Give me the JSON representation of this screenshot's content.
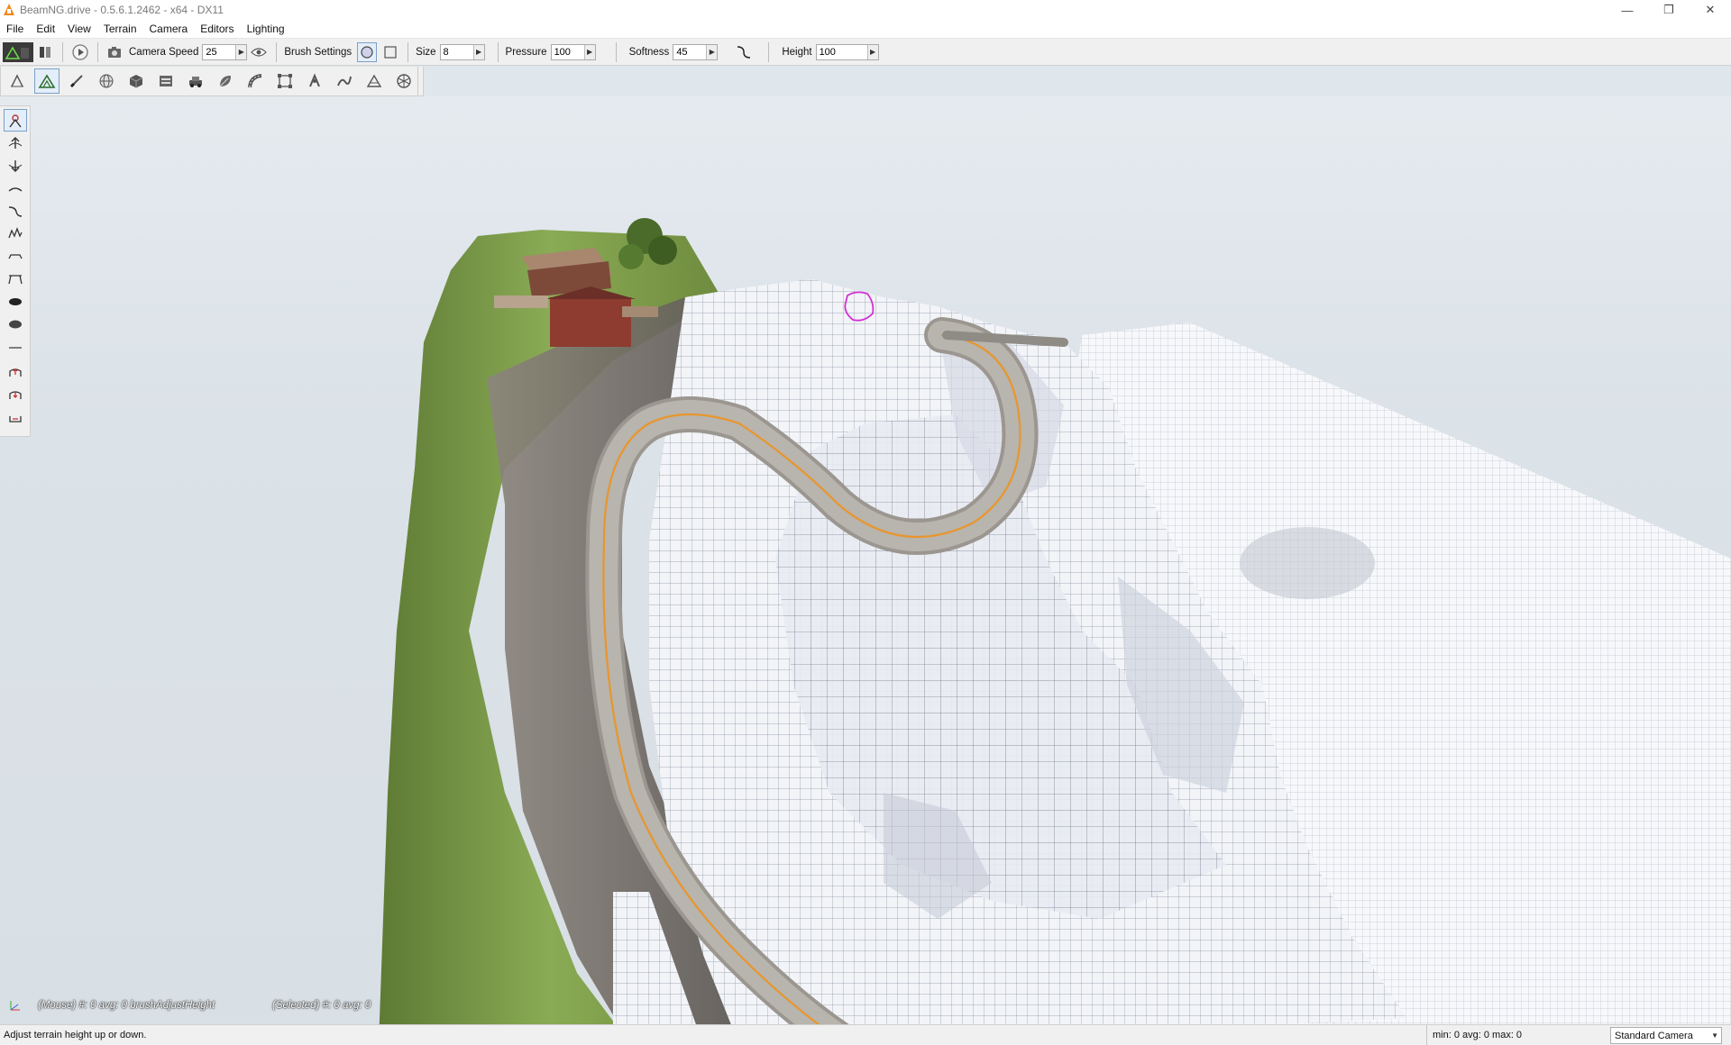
{
  "window": {
    "title": "BeamNG.drive - 0.5.6.1.2462 - x64 - DX11",
    "controls": {
      "minimize": "—",
      "restore": "❐",
      "close": "✕"
    }
  },
  "menu": {
    "items": [
      "File",
      "Edit",
      "View",
      "Terrain",
      "Camera",
      "Editors",
      "Lighting"
    ]
  },
  "toolbar": {
    "camera_speed_label": "Camera Speed",
    "camera_speed_value": "25",
    "brush_settings_label": "Brush Settings",
    "size_label": "Size",
    "size_value": "8",
    "pressure_label": "Pressure",
    "pressure_value": "100",
    "softness_label": "Softness",
    "softness_value": "45",
    "height_label": "Height",
    "height_value": "100"
  },
  "viewport": {
    "mouse_info": "(Mouse) #: 0  avg: 0 brushAdjustHeight",
    "selected_info": "(Selected) #: 0  avg: 0"
  },
  "statusbar": {
    "hint": "Adjust terrain height up or down.",
    "stats": "min: 0  avg: 0  max: 0",
    "camera": "Standard Camera"
  },
  "colors": {
    "sky": "#dde4ea",
    "grass": "#7ea24a",
    "rock": "#7c7670",
    "snow_mesh": "#eef0f6",
    "road": "#b0aca6",
    "road_line": "#e8962c",
    "brush_outline": "#d42fd4"
  }
}
